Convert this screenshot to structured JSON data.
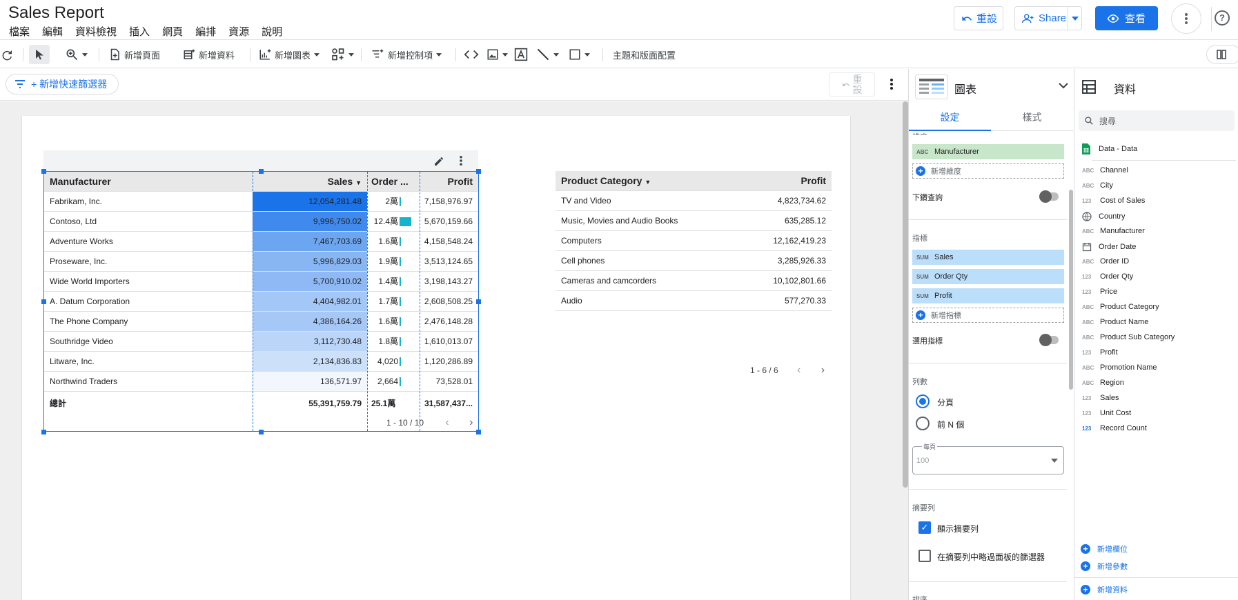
{
  "header": {
    "title": "Sales Report",
    "menu": [
      "檔案",
      "編輯",
      "資料檢視",
      "插入",
      "網頁",
      "編排",
      "資源",
      "說明"
    ],
    "reset_label": "重設",
    "share_label": "Share",
    "view_label": "查看",
    "help_label": "?"
  },
  "toolbar": {
    "add_page": "新增頁面",
    "add_data": "新增資料",
    "add_chart": "新增圖表",
    "add_control": "新增控制項",
    "theme_layout": "主題和版面配置"
  },
  "filterbar": {
    "quick_filter": "+ 新增快速篩選器",
    "reset_line1": "重",
    "reset_line2": "設"
  },
  "table1": {
    "headers": {
      "manufacturer": "Manufacturer",
      "sales": "Sales",
      "order_qty": "Order ...",
      "profit": "Profit"
    },
    "rows": [
      {
        "manufacturer": "Fabrikam, Inc.",
        "sales": "12,054,281.48",
        "qty": "2萬",
        "profit": "7,158,976.97",
        "heat": 1.0,
        "qtyfrac": 0.08
      },
      {
        "manufacturer": "Contoso, Ltd",
        "sales": "9,996,750.02",
        "qty": "12.4萬",
        "profit": "5,670,159.66",
        "heat": 0.83,
        "qtyfrac": 1.0
      },
      {
        "manufacturer": "Adventure Works",
        "sales": "7,467,703.69",
        "qty": "1.6萬",
        "profit": "4,158,548.24",
        "heat": 0.62,
        "qtyfrac": 0.06
      },
      {
        "manufacturer": "Proseware, Inc.",
        "sales": "5,996,829.03",
        "qty": "1.9萬",
        "profit": "3,513,124.65",
        "heat": 0.5,
        "qtyfrac": 0.08
      },
      {
        "manufacturer": "Wide World Importers",
        "sales": "5,700,910.02",
        "qty": "1.4萬",
        "profit": "3,198,143.27",
        "heat": 0.47,
        "qtyfrac": 0.06
      },
      {
        "manufacturer": "A. Datum Corporation",
        "sales": "4,404,982.01",
        "qty": "1.7萬",
        "profit": "2,608,508.25",
        "heat": 0.37,
        "qtyfrac": 0.07
      },
      {
        "manufacturer": "The Phone Company",
        "sales": "4,386,164.26",
        "qty": "1.6萬",
        "profit": "2,476,148.28",
        "heat": 0.36,
        "qtyfrac": 0.06
      },
      {
        "manufacturer": "Southridge Video",
        "sales": "3,112,730.48",
        "qty": "1.8萬",
        "profit": "1,610,013.07",
        "heat": 0.26,
        "qtyfrac": 0.07
      },
      {
        "manufacturer": "Litware, Inc.",
        "sales": "2,134,836.83",
        "qty": "4,020",
        "profit": "1,120,286.89",
        "heat": 0.18,
        "qtyfrac": 0.02
      },
      {
        "manufacturer": "Northwind Traders",
        "sales": "136,571.97",
        "qty": "2,664",
        "profit": "73,528.01",
        "heat": 0.01,
        "qtyfrac": 0.01
      }
    ],
    "total": {
      "label": "總計",
      "sales": "55,391,759.79",
      "qty": "25.1萬",
      "profit": "31,587,437..."
    },
    "pager": "1 - 10 / 10"
  },
  "table2": {
    "headers": {
      "category": "Product Category",
      "profit": "Profit"
    },
    "rows": [
      {
        "category": "TV and Video",
        "profit": "4,823,734.62"
      },
      {
        "category": "Music, Movies and Audio Books",
        "profit": "635,285.12"
      },
      {
        "category": "Computers",
        "profit": "12,162,419.23"
      },
      {
        "category": "Cell phones",
        "profit": "3,285,926.33"
      },
      {
        "category": "Cameras and camcorders",
        "profit": "10,102,801.66"
      },
      {
        "category": "Audio",
        "profit": "577,270.33"
      }
    ],
    "pager": "1 - 6 / 6"
  },
  "props": {
    "title": "圖表",
    "tab_setup": "設定",
    "tab_style": "樣式",
    "dimension_label": "維度",
    "dimension": "Manufacturer",
    "add_dimension": "新增維度",
    "drilldown": "下鑽查詢",
    "metric_label": "指標",
    "metrics": [
      "Sales",
      "Order Qty",
      "Profit"
    ],
    "add_metric": "新增指標",
    "optional_metric": "選用指標",
    "rows_label": "列數",
    "pagination": "分頁",
    "top_n": "前 N 個",
    "per_page_label": "每頁",
    "per_page_value": "100",
    "summary_label": "摘要列",
    "show_summary": "顯示摘要列",
    "ignore_filters": "在摘要列中略過面板的篩選器",
    "sort_label": "排序"
  },
  "data": {
    "title": "資料",
    "search_placeholder": "搜尋",
    "source": "Data - Data",
    "fields": [
      {
        "type": "ABC",
        "name": "Channel"
      },
      {
        "type": "ABC",
        "name": "City"
      },
      {
        "type": "123",
        "name": "Cost of Sales"
      },
      {
        "type": "globe",
        "name": "Country"
      },
      {
        "type": "ABC",
        "name": "Manufacturer"
      },
      {
        "type": "date",
        "name": "Order Date"
      },
      {
        "type": "ABC",
        "name": "Order ID"
      },
      {
        "type": "123",
        "name": "Order Qty"
      },
      {
        "type": "123",
        "name": "Price"
      },
      {
        "type": "ABC",
        "name": "Product Category"
      },
      {
        "type": "ABC",
        "name": "Product Name"
      },
      {
        "type": "ABC",
        "name": "Product Sub Category"
      },
      {
        "type": "123",
        "name": "Profit"
      },
      {
        "type": "ABC",
        "name": "Promotion Name"
      },
      {
        "type": "ABC",
        "name": "Region"
      },
      {
        "type": "123",
        "name": "Sales"
      },
      {
        "type": "123",
        "name": "Unit Cost"
      },
      {
        "type": "123",
        "name": "Record Count"
      }
    ],
    "add_field": "新增欄位",
    "add_param": "新增參數",
    "add_data": "新增資料"
  },
  "colors": {
    "accent": "#1a73e8",
    "heat_max": "#1a73e8",
    "heat_min": "#f4f8fe",
    "bar": "#12b5cb"
  }
}
